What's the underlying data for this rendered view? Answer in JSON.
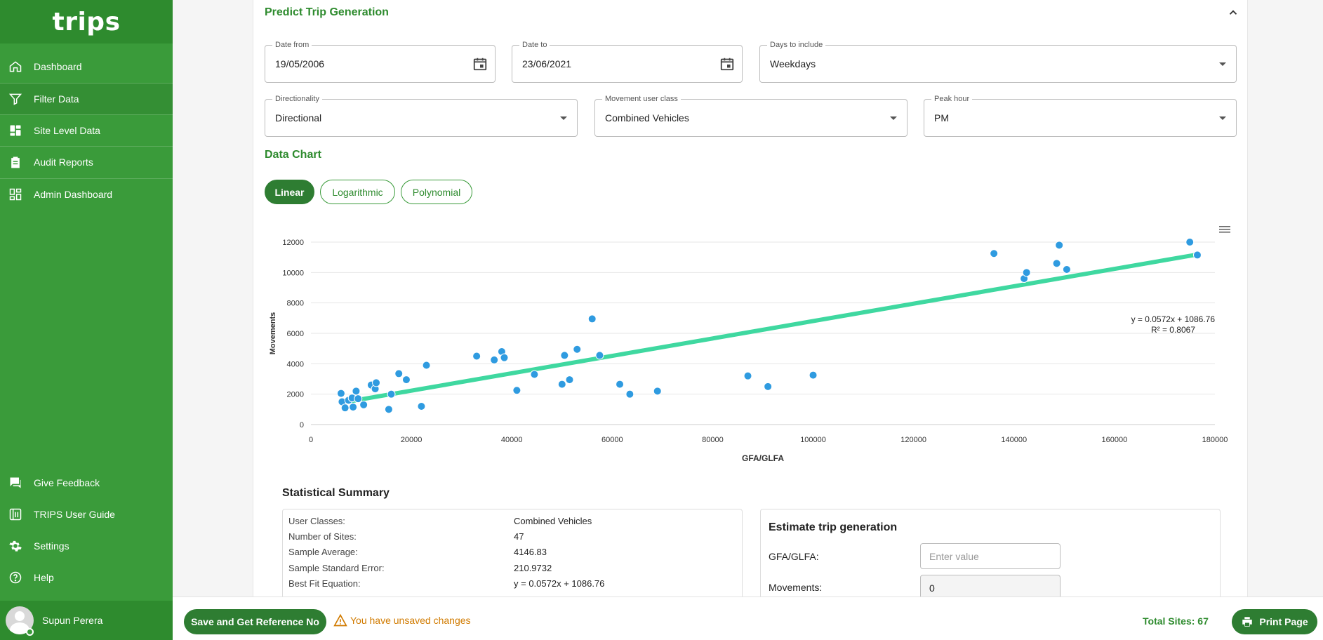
{
  "app": {
    "logo": "trips"
  },
  "sidebar": {
    "items": [
      {
        "label": "Dashboard",
        "icon": "home-icon"
      },
      {
        "label": "Filter Data",
        "icon": "filter-icon"
      },
      {
        "label": "Site Level Data",
        "icon": "dashboard-grid-icon"
      },
      {
        "label": "Audit Reports",
        "icon": "clipboard-icon"
      },
      {
        "label": "Admin Dashboard",
        "icon": "admin-grid-icon"
      }
    ],
    "bottom_items": [
      {
        "label": "Give Feedback",
        "icon": "feedback-icon"
      },
      {
        "label": "TRIPS User Guide",
        "icon": "guide-icon"
      },
      {
        "label": "Settings",
        "icon": "gear-icon"
      },
      {
        "label": "Help",
        "icon": "help-icon"
      }
    ],
    "user": {
      "name": "Supun Perera"
    }
  },
  "predict": {
    "title": "Predict Trip Generation",
    "date_from": {
      "label": "Date from",
      "value": "19/05/2006"
    },
    "date_to": {
      "label": "Date to",
      "value": "23/06/2021"
    },
    "days": {
      "label": "Days to include",
      "value": "Weekdays"
    },
    "directionality": {
      "label": "Directionality",
      "value": "Directional"
    },
    "user_class": {
      "label": "Movement user class",
      "value": "Combined Vehicles"
    },
    "peak_hour": {
      "label": "Peak hour",
      "value": "PM"
    }
  },
  "chart_section": {
    "title": "Data Chart",
    "modes": [
      "Linear",
      "Logarithmic",
      "Polynomial"
    ],
    "active_mode": "Linear"
  },
  "chart_data": {
    "type": "scatter",
    "title": "",
    "xlabel": "GFA/GLFA",
    "ylabel": "Movements",
    "xlim": [
      0,
      180000
    ],
    "ylim": [
      0,
      12000
    ],
    "xticks": [
      0,
      20000,
      40000,
      60000,
      80000,
      100000,
      120000,
      140000,
      160000,
      180000
    ],
    "yticks": [
      0,
      2000,
      4000,
      6000,
      8000,
      10000,
      12000
    ],
    "grid": true,
    "point_color": "#2f9be0",
    "trend_color": "#3fd8a0",
    "trendline": {
      "slope": 0.0572,
      "intercept": 1086.76,
      "x_range": [
        7000,
        176000
      ]
    },
    "equation_label": "y = 0.0572x + 1086.76",
    "r2_label": "R² = 0.8067",
    "points": [
      [
        6000,
        2050
      ],
      [
        6200,
        1500
      ],
      [
        6800,
        1100
      ],
      [
        7500,
        1600
      ],
      [
        8200,
        1750
      ],
      [
        8400,
        1150
      ],
      [
        9000,
        2200
      ],
      [
        9400,
        1700
      ],
      [
        10500,
        1300
      ],
      [
        12000,
        2600
      ],
      [
        12800,
        2350
      ],
      [
        13000,
        2750
      ],
      [
        15500,
        1000
      ],
      [
        16000,
        2000
      ],
      [
        17500,
        3350
      ],
      [
        19000,
        2950
      ],
      [
        22000,
        1200
      ],
      [
        23000,
        3900
      ],
      [
        33000,
        4500
      ],
      [
        36500,
        4250
      ],
      [
        38000,
        4800
      ],
      [
        38500,
        4400
      ],
      [
        41000,
        2250
      ],
      [
        44500,
        3300
      ],
      [
        50000,
        2650
      ],
      [
        50500,
        4550
      ],
      [
        51500,
        2950
      ],
      [
        53000,
        4950
      ],
      [
        56000,
        6950
      ],
      [
        57500,
        4550
      ],
      [
        61500,
        2650
      ],
      [
        63500,
        2000
      ],
      [
        69000,
        2200
      ],
      [
        87000,
        3200
      ],
      [
        91000,
        2500
      ],
      [
        100000,
        3250
      ],
      [
        136000,
        11250
      ],
      [
        142000,
        9600
      ],
      [
        142500,
        10000
      ],
      [
        148500,
        10600
      ],
      [
        149000,
        11800
      ],
      [
        150500,
        10200
      ],
      [
        175000,
        12000
      ],
      [
        176500,
        11150
      ]
    ]
  },
  "stats": {
    "title": "Statistical Summary",
    "rows": [
      {
        "label": "User Classes:",
        "value": "Combined Vehicles"
      },
      {
        "label": "Number of Sites:",
        "value": "47"
      },
      {
        "label": "Sample Average:",
        "value": "4146.83"
      },
      {
        "label": "Sample Standard Error:",
        "value": "210.9732"
      },
      {
        "label": "Best Fit Equation:",
        "value": "y = 0.0572x + 1086.76"
      }
    ]
  },
  "estimate": {
    "title": "Estimate trip generation",
    "gfa_label": "GFA/GLFA:",
    "gfa_placeholder": "Enter value",
    "movements_label": "Movements:",
    "movements_value": "0"
  },
  "bottom": {
    "save_label": "Save and Get Reference No",
    "unsaved_text": "You have unsaved changes",
    "total_sites": "Total Sites: 67",
    "print_label": "Print Page"
  }
}
